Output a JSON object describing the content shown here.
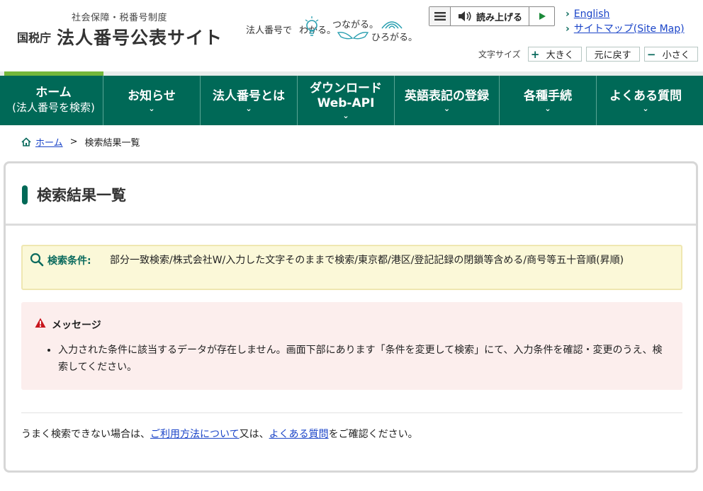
{
  "header": {
    "subtitle": "社会保障・税番号制度",
    "agency": "国税庁",
    "site_title": "法人番号公表サイト",
    "tagline": {
      "a": "法人番号で",
      "b": "わかる。",
      "c": "つながる。",
      "d": "ひろがる。"
    },
    "readbar_label": "読み上げる",
    "links": {
      "english": "English",
      "sitemap": "サイトマップ(Site Map)"
    },
    "fontsize": {
      "label": "文字サイズ",
      "bigger": "大きく",
      "reset": "元に戻す",
      "smaller": "小さく",
      "plus": "+",
      "minus": "−"
    }
  },
  "nav": {
    "items": [
      {
        "label1": "ホーム",
        "label2": "(法人番号を検索)"
      },
      {
        "label1": "お知らせ"
      },
      {
        "label1": "法人番号とは"
      },
      {
        "label1": "ダウンロード",
        "label2": "Web-API"
      },
      {
        "label1": "英語表記の登録"
      },
      {
        "label1": "各種手続"
      },
      {
        "label1": "よくある質問"
      }
    ]
  },
  "breadcrumb": {
    "home": "ホーム",
    "sep": ">",
    "current": "検索結果一覧"
  },
  "main": {
    "title": "検索結果一覧",
    "condition_label": "検索条件:",
    "condition_value": "部分一致検索/株式会社W/入力した文字そのままで検索/東京都/港区/登記記録の閉鎖等含める/商号等五十音順(昇順)",
    "message_title": "メッセージ",
    "message_text": "入力された条件に該当するデータが存在しません。画面下部にあります「条件を変更して検索」にて、入力条件を確認・変更のうえ、検索してください。",
    "help_prefix": "うまく検索できない場合は、",
    "help_link1": "ご利用方法について",
    "help_mid": "又は、",
    "help_link2": "よくある質問",
    "help_suffix": "をご確認ください。"
  },
  "colors": {
    "brand_green": "#006957",
    "accent_green": "#74b73b",
    "link": "#1a44c8"
  }
}
